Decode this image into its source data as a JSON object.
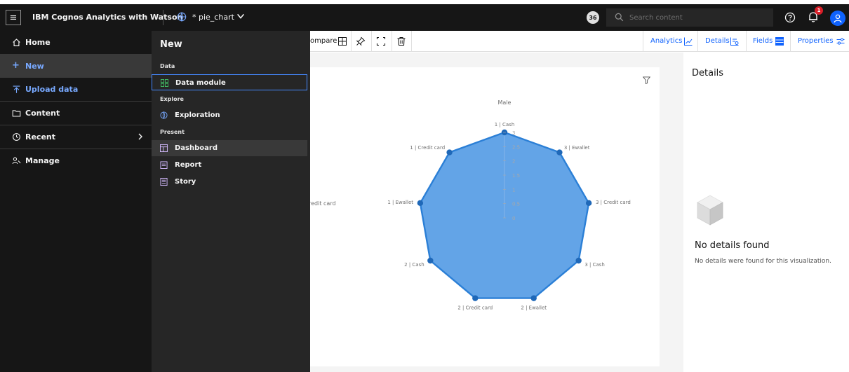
{
  "header": {
    "app_title": "IBM Cognos Analytics with Watson",
    "doc_title": "* pie_chart",
    "count_badge": "36",
    "search_placeholder": "Search content",
    "notification_count": "1"
  },
  "nav": {
    "home": "Home",
    "new": "New",
    "upload": "Upload data",
    "content": "Content",
    "recent": "Recent",
    "manage": "Manage"
  },
  "flyout": {
    "title": "New",
    "sections": {
      "data": "Data",
      "explore": "Explore",
      "present": "Present"
    },
    "items": {
      "data_module": "Data module",
      "exploration": "Exploration",
      "dashboard": "Dashboard",
      "report": "Report",
      "story": "Story"
    }
  },
  "toolbar": {
    "compare": "ompare",
    "tabs": {
      "analytics": "Analytics",
      "details": "Details",
      "fields": "Fields",
      "properties": "Properties"
    }
  },
  "details_panel": {
    "title": "Details",
    "empty_title": "No details found",
    "empty_text": "No details were found for this visualization."
  },
  "colors": {
    "accent": "#0f62fe",
    "link": "#78a9ff",
    "radar_fill": "#5b9fe6",
    "radar_stroke": "#2b7fd6",
    "radar_point": "#1f68b8"
  },
  "chart_data": {
    "type": "radar",
    "title": "Male",
    "clipped_label": "redit card",
    "radial_ticks": [
      "0",
      "0.5",
      "1",
      "1.5",
      "2",
      "2.5",
      "3"
    ],
    "rmax": 3,
    "categories": [
      "1 | Cash",
      "3 | Ewallet",
      "3 | Credit card",
      "3 | Cash",
      "2 | Ewallet",
      "2 | Credit card",
      "2 | Cash",
      "1 | Ewallet",
      "1 | Credit card"
    ],
    "values": [
      3,
      3,
      3,
      3,
      3,
      3,
      3,
      3,
      3
    ]
  }
}
